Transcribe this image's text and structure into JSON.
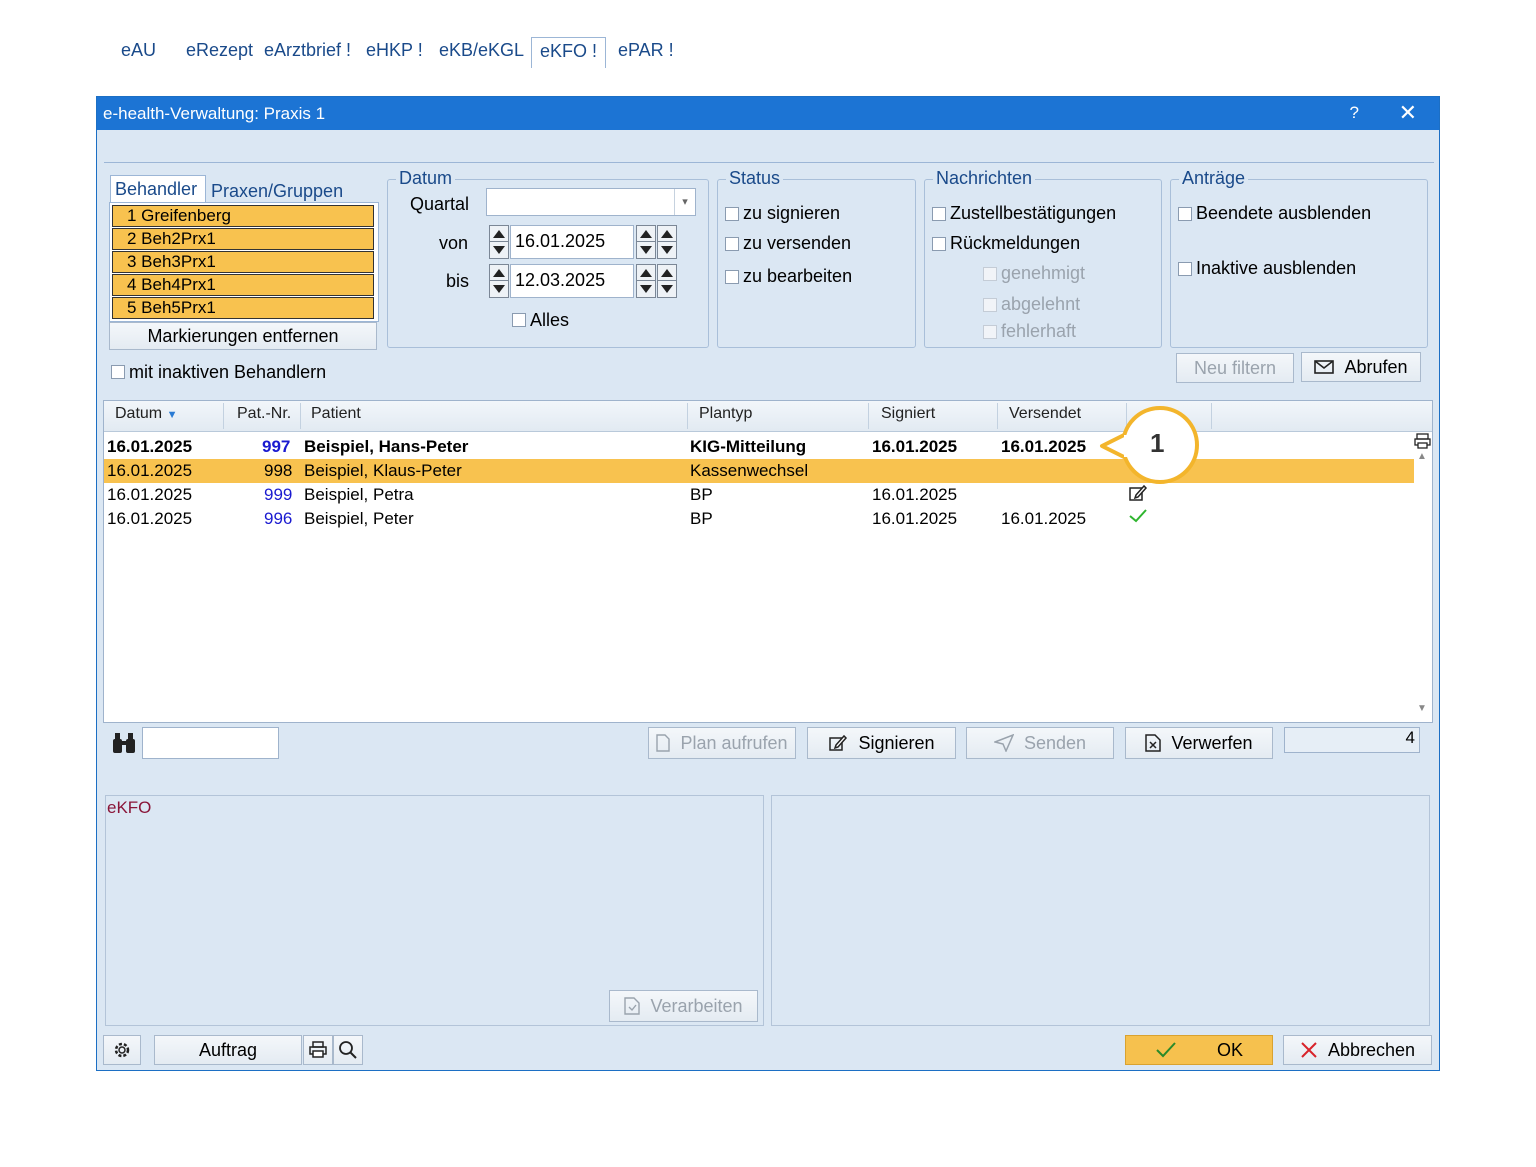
{
  "window": {
    "title": "e-health-Verwaltung: Praxis 1",
    "help": "?",
    "close": "✕"
  },
  "tabs": [
    "eAU",
    "eRezept",
    "eArztbrief !",
    "eHKP !",
    "eKB/eKGL",
    "eKFO !",
    "ePAR !"
  ],
  "active_tab": "eKFO !",
  "left_tabs": [
    "Behandler",
    "Praxen/Gruppen"
  ],
  "behandler": [
    "1 Greifenberg",
    "2 Beh2Prx1",
    "3 Beh3Prx1",
    "4 Beh4Prx1",
    "5 Beh5Prx1"
  ],
  "markierungen_button": "Markierungen entfernen",
  "inaktive_behandler": "mit inaktiven Behandlern",
  "datum": {
    "legend": "Datum",
    "quartal_label": "Quartal",
    "quartal_value": "",
    "von_label": "von",
    "von": "16.01.2025",
    "bis_label": "bis",
    "bis": "12.03.2025",
    "alles": "Alles"
  },
  "status": {
    "legend": "Status",
    "items": [
      "zu signieren",
      "zu versenden",
      "zu bearbeiten"
    ]
  },
  "nachrichten": {
    "legend": "Nachrichten",
    "items": [
      "Zustellbestätigungen",
      "Rückmeldungen"
    ],
    "sub_items": [
      "genehmigt",
      "abgelehnt",
      "fehlerhaft"
    ]
  },
  "antraege": {
    "legend": "Anträge",
    "items": [
      "Beendete ausblenden",
      "Inaktive ausblenden"
    ]
  },
  "filter_buttons": {
    "neu_filtern": "Neu filtern",
    "abrufen": "Abrufen"
  },
  "table": {
    "headers": [
      "Datum",
      "Pat.-Nr.",
      "Patient",
      "Plantyp",
      "Signiert",
      "Versendet"
    ],
    "rows": [
      {
        "datum": "16.01.2025",
        "nr": "997",
        "patient": "Beispiel, Hans-Peter",
        "plantyp": "KIG-Mitteilung",
        "signiert": "16.01.2025",
        "versendet": "16.01.2025",
        "icon": "",
        "bold": true
      },
      {
        "datum": "16.01.2025",
        "nr": "998",
        "patient": "Beispiel, Klaus-Peter",
        "plantyp": "Kassenwechsel",
        "signiert": "",
        "versendet": "",
        "icon": "",
        "selected": true
      },
      {
        "datum": "16.01.2025",
        "nr": "999",
        "patient": "Beispiel, Petra",
        "plantyp": "BP",
        "signiert": "16.01.2025",
        "versendet": "",
        "icon": "edit-icon"
      },
      {
        "datum": "16.01.2025",
        "nr": "996",
        "patient": "Beispiel, Peter",
        "plantyp": "BP",
        "signiert": "16.01.2025",
        "versendet": "16.01.2025",
        "icon": "check-icon"
      }
    ]
  },
  "callout": "1",
  "actions": {
    "plan_aufrufen": "Plan aufrufen",
    "signieren": "Signieren",
    "senden": "Senden",
    "verwerfen": "Verwerfen",
    "count": "4",
    "search_value": ""
  },
  "bottom": {
    "ekfo_label": "eKFO",
    "verarbeiten": "Verarbeiten"
  },
  "footer": {
    "auftrag": "Auftrag",
    "ok": "OK",
    "abbrechen": "Abbrechen"
  },
  "colors": {
    "title_bar": "#1c74d4",
    "highlight": "#f8c24f",
    "callout": "#f3b52c",
    "ok_button": "#f6c14e",
    "cancel_x": "#d8232a",
    "check": "#2fb52f"
  }
}
